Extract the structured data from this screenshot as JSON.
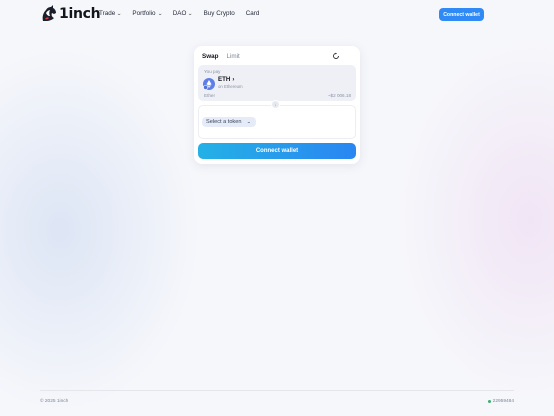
{
  "header": {
    "logo_text": "1inch",
    "nav": [
      {
        "label": "Trade",
        "has_dropdown": true
      },
      {
        "label": "Portfolio",
        "has_dropdown": true
      },
      {
        "label": "DAO",
        "has_dropdown": true
      },
      {
        "label": "Buy Crypto",
        "has_dropdown": false
      },
      {
        "label": "Card",
        "has_dropdown": false
      }
    ],
    "connect_wallet_label": "Connect wallet"
  },
  "swap": {
    "tabs": [
      {
        "label": "Swap",
        "active": true
      },
      {
        "label": "Limit",
        "active": false
      }
    ],
    "refresh_icon": "refresh-icon",
    "you_pay_label": "You pay",
    "token": {
      "symbol": "ETH",
      "network": "on Ethereum",
      "name": "Ether",
      "usd_value": "~$2 006.18",
      "icon": "ethereum-icon"
    },
    "swap_direction_icon": "arrow-down-icon",
    "select_token_label": "Select a token",
    "connect_wallet_label": "Connect wallet"
  },
  "footer": {
    "copyright": "© 2025 1inch",
    "block_number": "22959484",
    "status_color": "#35b06f"
  },
  "colors": {
    "accent": "#2f8af5",
    "gradient_start": "#24b1e6",
    "gradient_end": "#2a86f2"
  }
}
